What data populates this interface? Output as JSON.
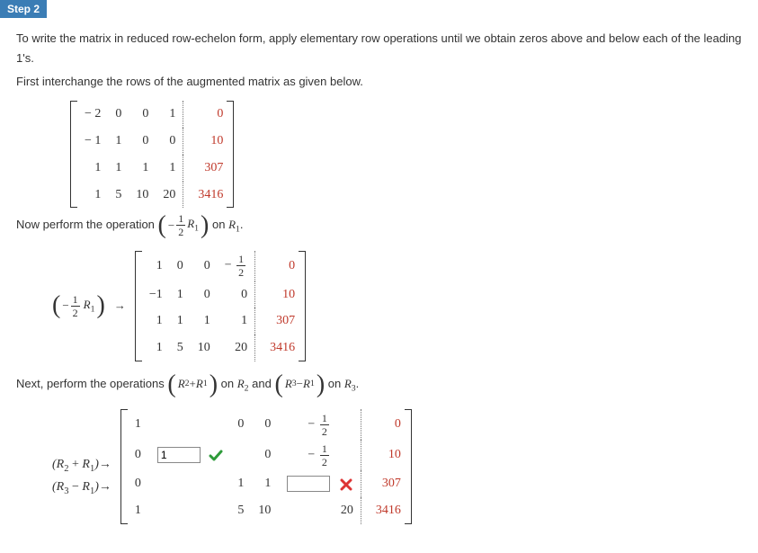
{
  "step_label": "Step 2",
  "intro_line1": "To write the matrix in reduced row-echelon form, apply elementary row operations until we obtain zeros above and below each of the leading  1's.",
  "intro_line2": "First interchange the rows of the augmented matrix as given below.",
  "matrix1": {
    "r1": {
      "c1": "− 2",
      "c2": "0",
      "c3": "0",
      "c4": "1",
      "aug": "0"
    },
    "r2": {
      "c1": "− 1",
      "c2": "1",
      "c3": "0",
      "c4": "0",
      "aug": "10"
    },
    "r3": {
      "c1": "1",
      "c2": "1",
      "c3": "1",
      "c4": "1",
      "aug": "307"
    },
    "r4": {
      "c1": "1",
      "c2": "5",
      "c3": "10",
      "c4": "20",
      "aug": "3416"
    }
  },
  "now_perform_prefix": "Now perform the operation ",
  "op1_frac_top": "1",
  "op1_frac_bot": "2",
  "op1_R": "R",
  "op1_sub": "1",
  "on_text": " on ",
  "R1_label": "R",
  "R1_sub": "1",
  "period": ".",
  "arrow_label_prefix_open": "(",
  "arrow_label_prefix_close": ")",
  "arrow_glyph": "→",
  "matrix2": {
    "r1": {
      "c1": "1",
      "c2": "0",
      "c3": "0",
      "c4_prefix": "−",
      "aug": "0"
    },
    "r2": {
      "c1": "−1",
      "c2": "1",
      "c3": "0",
      "c4": "0",
      "aug": "10"
    },
    "r3": {
      "c1": "1",
      "c2": "1",
      "c3": "1",
      "c4": "1",
      "aug": "307"
    },
    "r4": {
      "c1": "1",
      "c2": "5",
      "c3": "10",
      "c4": "20",
      "aug": "3416"
    }
  },
  "next_perform_prefix": "Next, perform the operations ",
  "op2a_inner": "R₂ + R₁",
  "on_R2": " on ",
  "R2_label": "R",
  "R2_sub": "2",
  "and_text": " and ",
  "op2b_inner": "R₃ − R₁",
  "on_R3": " on ",
  "R3_label": "R",
  "R3_sub": "3",
  "row_op_label_a": "(R₂ + R₁)→",
  "row_op_label_b": "(R₃ − R₁)→",
  "matrix3": {
    "r1": {
      "c1": "1",
      "c2": "",
      "c3": "0",
      "c4": "0",
      "c5_prefix": "−",
      "aug": "0"
    },
    "r2": {
      "c1": "0",
      "c2_input": "1",
      "c3": "",
      "c4": "0",
      "c5_prefix": "−",
      "aug": "10"
    },
    "r3": {
      "c1": "0",
      "c2": "",
      "c3": "1",
      "c4": "1",
      "c5_input": "",
      "aug": "307"
    },
    "r4": {
      "c1": "1",
      "c2": "",
      "c3": "5",
      "c4": "10",
      "c5": "20",
      "aug": "3416"
    }
  },
  "half_top": "1",
  "half_bot": "2"
}
